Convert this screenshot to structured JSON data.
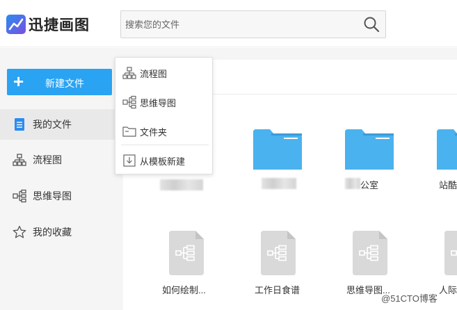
{
  "app": {
    "name": "迅捷画图"
  },
  "search": {
    "placeholder": "搜索您的文件"
  },
  "sidebar": {
    "new_button": "新建文件",
    "items": [
      {
        "label": "我的文件",
        "icon": "file-icon",
        "active": true
      },
      {
        "label": "流程图",
        "icon": "flowchart-icon"
      },
      {
        "label": "思维导图",
        "icon": "mindmap-icon"
      },
      {
        "label": "我的收藏",
        "icon": "star-icon"
      }
    ]
  },
  "dropdown": {
    "items": [
      {
        "label": "流程图",
        "icon": "flowchart-icon"
      },
      {
        "label": "思维导图",
        "icon": "mindmap-icon"
      },
      {
        "label": "文件夹",
        "icon": "folder-icon"
      },
      {
        "label": "从模板新建",
        "icon": "template-icon"
      }
    ]
  },
  "files": {
    "folders": [
      {
        "name": ""
      },
      {
        "name": ""
      },
      {
        "name": "公室"
      },
      {
        "name": "站酷"
      }
    ],
    "mindmaps": [
      {
        "name": "如何绘制..."
      },
      {
        "name": "工作日食谱"
      },
      {
        "name": "思维导图..."
      },
      {
        "name": "人际"
      }
    ]
  },
  "colors": {
    "accent": "#2aa3f3",
    "folder": "#4ab2ee",
    "folder_tab": "#3c9ad6",
    "card": "#d9d9d9"
  },
  "watermark": "@51CTO博客"
}
